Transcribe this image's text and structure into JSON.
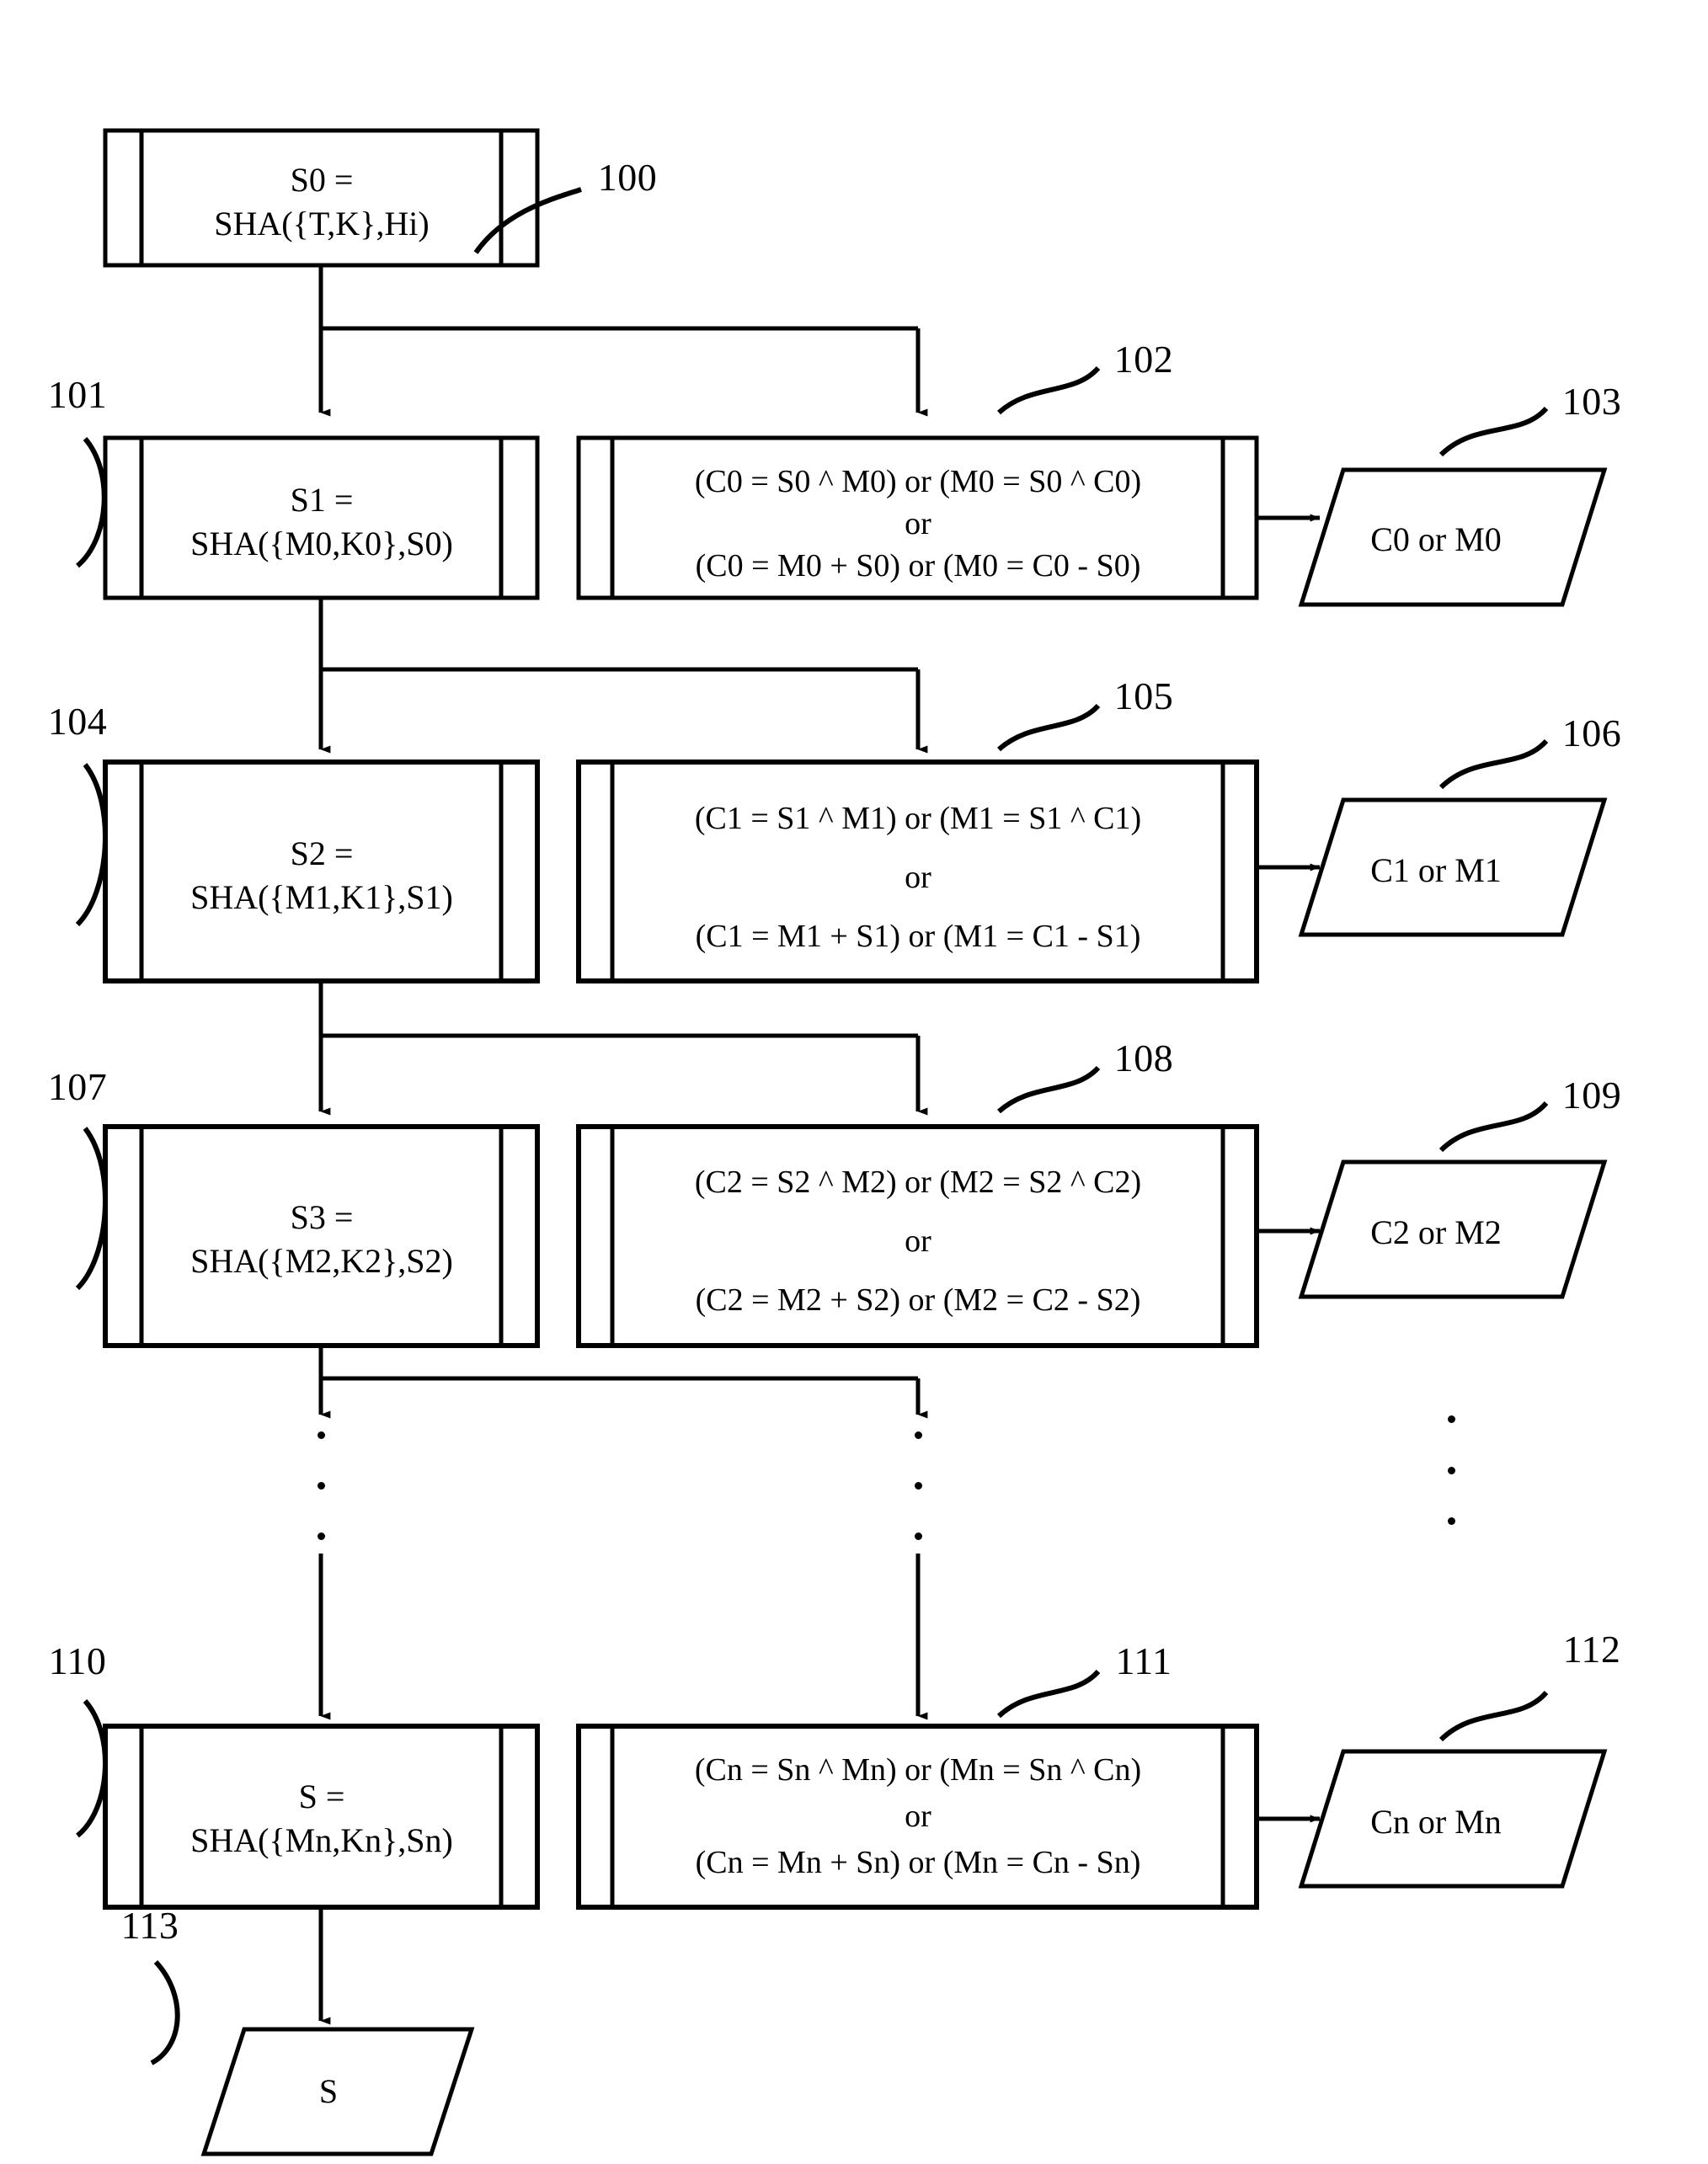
{
  "figure": {
    "type": "patent-flow-diagram",
    "background_color": "#ffffff",
    "line_color": "#000000"
  },
  "stages": [
    {
      "ref": "100",
      "process_line1": "S0 =",
      "process_line2": "SHA({T,K},Hi)"
    },
    {
      "ref": "101",
      "process_line1": "S1 =",
      "process_line2": "SHA({M0,K0},S0)",
      "expr_ref": "102",
      "expr_line1": "(C0 = S0 ^ M0) or (M0 = S0 ^ C0)",
      "expr_line2": "or",
      "expr_line3": "(C0 = M0 + S0) or (M0 = C0 - S0)",
      "io_ref": "103",
      "io_label": "C0 or M0"
    },
    {
      "ref": "104",
      "process_line1": "S2 =",
      "process_line2": "SHA({M1,K1},S1)",
      "expr_ref": "105",
      "expr_line1": "(C1 = S1 ^ M1) or (M1 = S1 ^ C1)",
      "expr_line2": "or",
      "expr_line3": "(C1 = M1 + S1) or (M1 = C1 - S1)",
      "io_ref": "106",
      "io_label": "C1 or M1"
    },
    {
      "ref": "107",
      "process_line1": "S3 =",
      "process_line2": "SHA({M2,K2},S2)",
      "expr_ref": "108",
      "expr_line1": "(C2 = S2 ^ M2) or (M2 = S2 ^ C2)",
      "expr_line2": "or",
      "expr_line3": "(C2 = M2 + S2) or (M2 = C2 - S2)",
      "io_ref": "109",
      "io_label": "C2 or M2"
    },
    {
      "ref": "110",
      "process_line1": "S =",
      "process_line2": "SHA({Mn,Kn},Sn)",
      "expr_ref": "111",
      "expr_line1": "(Cn = Sn ^ Mn) or (Mn = Sn ^ Cn)",
      "expr_line2": "or",
      "expr_line3": "(Cn = Mn + Sn) or (Mn = Cn - Sn)",
      "io_ref": "112",
      "io_label": "Cn or Mn"
    }
  ],
  "final_output": {
    "ref": "113",
    "label": "S"
  }
}
